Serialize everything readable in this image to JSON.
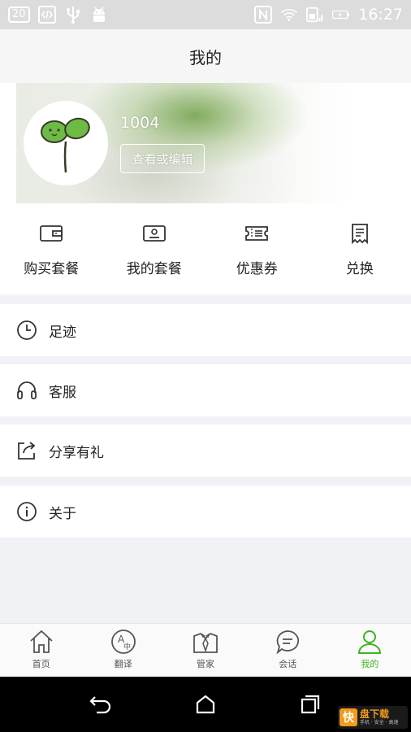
{
  "status_bar": {
    "badge": "20",
    "time": "16:27"
  },
  "header": {
    "title": "我的"
  },
  "profile": {
    "username": "1004",
    "edit_label": "查看或编辑"
  },
  "quick_actions": [
    {
      "label": "购买套餐",
      "icon": "wallet-icon"
    },
    {
      "label": "我的套餐",
      "icon": "id-card-icon"
    },
    {
      "label": "优惠券",
      "icon": "coupon-icon"
    },
    {
      "label": "兑换",
      "icon": "receipt-icon"
    }
  ],
  "menu": [
    {
      "label": "足迹",
      "icon": "clock-icon"
    },
    {
      "label": "客服",
      "icon": "headset-icon"
    },
    {
      "label": "分享有礼",
      "icon": "share-icon"
    },
    {
      "label": "关于",
      "icon": "info-icon"
    }
  ],
  "bottom_nav": [
    {
      "label": "首页",
      "icon": "home-icon"
    },
    {
      "label": "翻译",
      "icon": "translate-icon"
    },
    {
      "label": "管家",
      "icon": "butler-icon"
    },
    {
      "label": "会话",
      "icon": "chat-icon"
    },
    {
      "label": "我的",
      "icon": "person-icon",
      "active": true
    }
  ],
  "watermark": {
    "logo": "快",
    "main": "盘下载",
    "sub": "手机 · 安全 · 高速"
  },
  "colors": {
    "accent": "#3cb521",
    "background": "#f1f2f6",
    "text": "#222222"
  }
}
